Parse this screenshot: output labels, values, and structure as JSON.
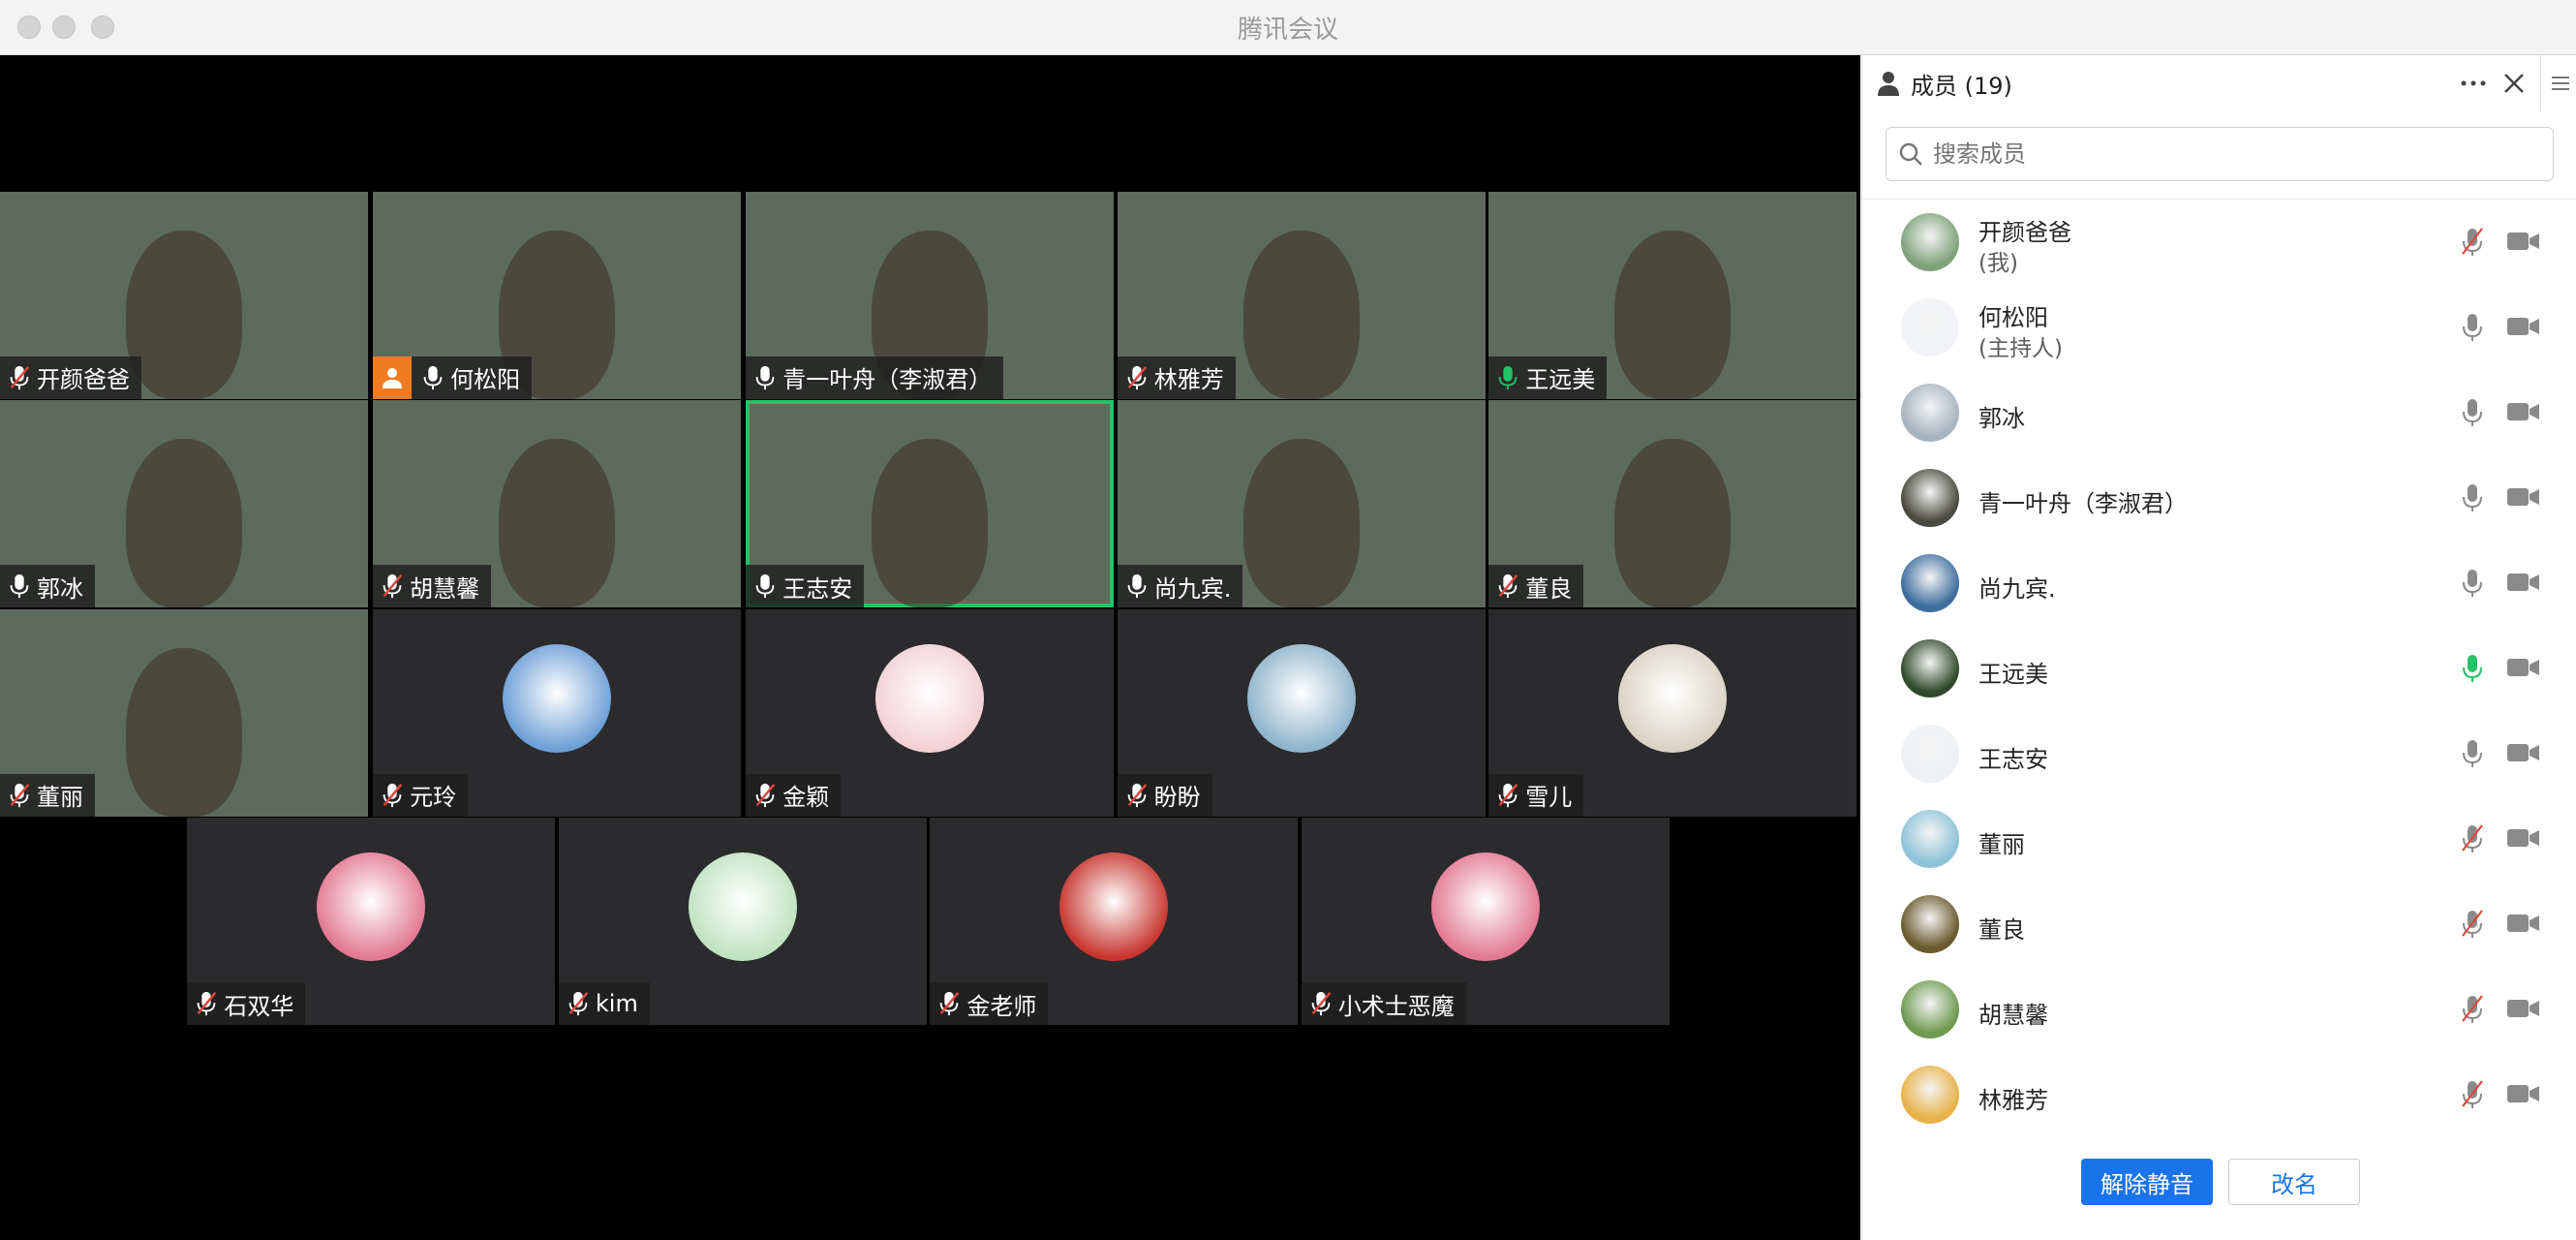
{
  "window": {
    "title": "腾讯会议"
  },
  "tiles": [
    {
      "name": "开颜爸爸",
      "mic": "muted",
      "kind": "video",
      "bg": "bg-hills"
    },
    {
      "name": "何松阳",
      "mic": "on",
      "kind": "video",
      "bg": "bg-room",
      "host": true
    },
    {
      "name": "青一叶舟（李淑君）",
      "mic": "on",
      "kind": "video",
      "bg": "bg-leaf"
    },
    {
      "name": "林雅芳",
      "mic": "muted",
      "kind": "video",
      "bg": "bg-shelf"
    },
    {
      "name": "王远美",
      "mic": "speaking",
      "kind": "video",
      "bg": "bg-sky"
    },
    {
      "name": "郭冰",
      "mic": "on",
      "kind": "video",
      "bg": "bg-room"
    },
    {
      "name": "胡慧馨",
      "mic": "muted",
      "kind": "video",
      "bg": "bg-room"
    },
    {
      "name": "王志安",
      "mic": "on",
      "kind": "video",
      "bg": "bg-room",
      "active": true
    },
    {
      "name": "尚九宾.",
      "mic": "on",
      "kind": "video",
      "bg": "bg-hills"
    },
    {
      "name": "董良",
      "mic": "muted",
      "kind": "video",
      "bg": "bg-hills"
    },
    {
      "name": "董丽",
      "mic": "muted",
      "kind": "video",
      "bg": "bg-star"
    },
    {
      "name": "元玲",
      "mic": "muted",
      "kind": "avatar",
      "avatar_color": "#6e9fd6"
    },
    {
      "name": "金颖",
      "mic": "muted",
      "kind": "avatar",
      "avatar_color": "#f3d0d6"
    },
    {
      "name": "盼盼",
      "mic": "muted",
      "kind": "avatar",
      "avatar_color": "#8fb4cc"
    },
    {
      "name": "雪儿",
      "mic": "muted",
      "kind": "avatar",
      "avatar_color": "#d9d3c4"
    },
    {
      "name": "石双华",
      "mic": "muted",
      "kind": "avatar",
      "avatar_color": "#e27894"
    },
    {
      "name": "kim",
      "mic": "muted",
      "kind": "avatar",
      "avatar_color": "#bfe3c1"
    },
    {
      "name": "金老师",
      "mic": "muted",
      "kind": "avatar",
      "avatar_color": "#c7352f"
    },
    {
      "name": "小术士恶魔",
      "mic": "muted",
      "kind": "avatar",
      "avatar_color": "#e27894"
    }
  ],
  "panel": {
    "title": "成员 (19)",
    "icons": {
      "person": "person-icon",
      "more": "more-icon",
      "close": "close-icon",
      "menu": "menu-icon"
    },
    "search_placeholder": "搜索成员",
    "members": [
      {
        "name": "开颜爸爸",
        "sub": "(我)",
        "mic": "muted",
        "avatar_color": "#7fa27a"
      },
      {
        "name": "何松阳",
        "sub": "(主持人)",
        "mic": "on",
        "avatar_color": "#f1f3f6"
      },
      {
        "name": "郭冰",
        "mic": "on",
        "avatar_color": "#a7b4c0"
      },
      {
        "name": "青一叶舟（李淑君）",
        "mic": "on",
        "avatar_color": "#4a4a40"
      },
      {
        "name": "尚九宾.",
        "mic": "on",
        "avatar_color": "#3e6e9e"
      },
      {
        "name": "王远美",
        "mic": "speaking",
        "avatar_color": "#2f4a2a"
      },
      {
        "name": "王志安",
        "mic": "on",
        "avatar_color": "#eef1f4"
      },
      {
        "name": "董丽",
        "mic": "muted",
        "avatar_color": "#8ec3d9"
      },
      {
        "name": "董良",
        "mic": "muted",
        "avatar_color": "#6a5a2e"
      },
      {
        "name": "胡慧馨",
        "mic": "muted",
        "avatar_color": "#6f9a52"
      },
      {
        "name": "林雅芳",
        "mic": "muted",
        "avatar_color": "#e8b24a"
      }
    ],
    "buttons": {
      "unmute": "解除静音",
      "rename": "改名"
    }
  },
  "colors": {
    "speaking": "#23c267",
    "muted": "#e0463c",
    "accent": "#1a73e8",
    "host_badge": "#f07b22"
  }
}
